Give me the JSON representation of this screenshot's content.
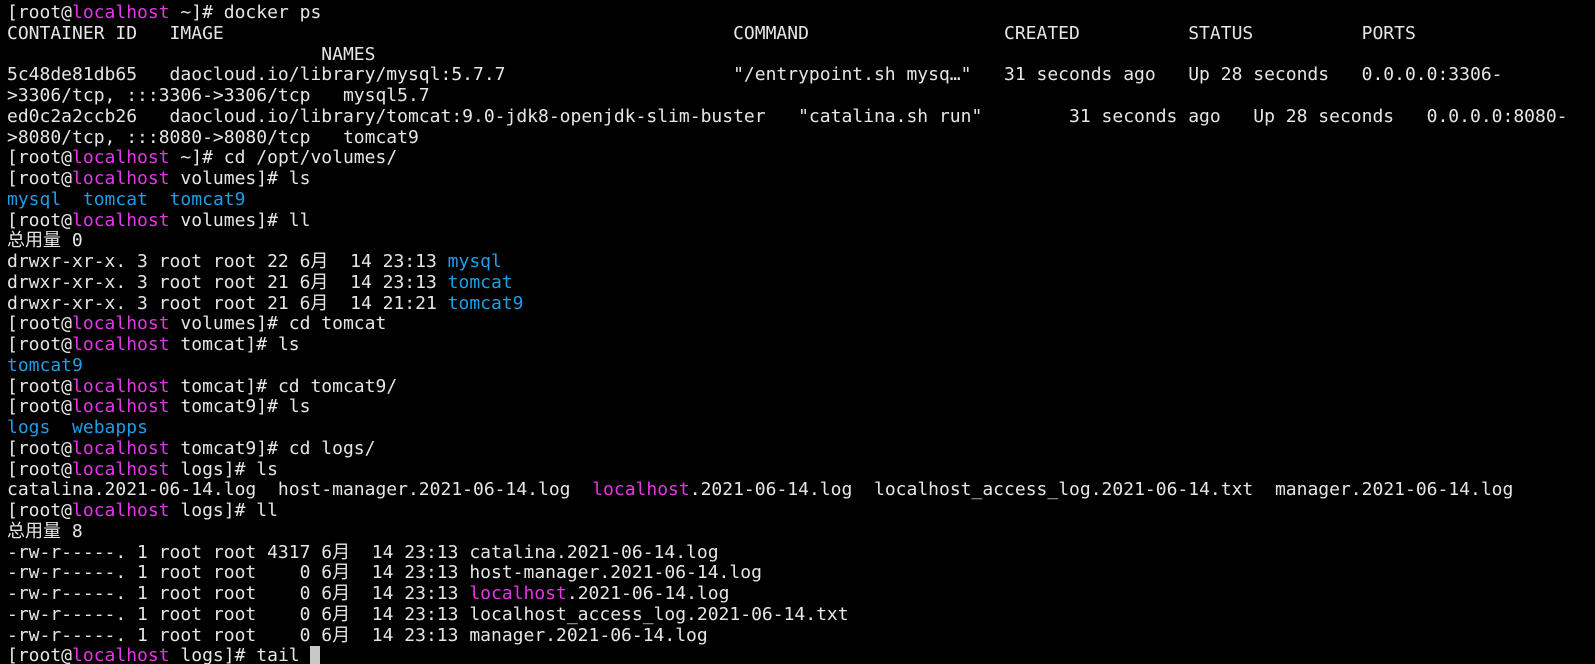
{
  "window": {
    "title": ""
  },
  "colors": {
    "background": "#000000",
    "text": "#e6e6e6",
    "hostname": "#e536e5",
    "directory": "#1e9ee6",
    "cursor": "#c8c8c8"
  },
  "lines": [
    {
      "kind": "prompt",
      "segments": [
        {
          "text": "[root@",
          "style": "default"
        },
        {
          "text": "localhost",
          "style": "host"
        },
        {
          "text": " ~]# docker ps",
          "style": "default"
        }
      ]
    },
    {
      "kind": "output",
      "segments": [
        {
          "text": "CONTAINER ID   IMAGE                                               COMMAND                  CREATED          STATUS          PORTS",
          "style": "default"
        }
      ]
    },
    {
      "kind": "output",
      "segments": [
        {
          "text": "                             NAMES",
          "style": "default"
        }
      ]
    },
    {
      "kind": "output",
      "segments": [
        {
          "text": "5c48de81db65   daocloud.io/library/mysql:5.7.7                     \"/entrypoint.sh mysq…\"   31 seconds ago   Up 28 seconds   0.0.0.0:3306-",
          "style": "default"
        }
      ]
    },
    {
      "kind": "output",
      "segments": [
        {
          "text": ">3306/tcp, :::3306->3306/tcp   mysql5.7",
          "style": "default"
        }
      ]
    },
    {
      "kind": "output",
      "segments": [
        {
          "text": "ed0c2a2ccb26   daocloud.io/library/tomcat:9.0-jdk8-openjdk-slim-buster   \"catalina.sh run\"        31 seconds ago   Up 28 seconds   0.0.0.0:8080-",
          "style": "default"
        }
      ]
    },
    {
      "kind": "output",
      "segments": [
        {
          "text": ">8080/tcp, :::8080->8080/tcp   tomcat9",
          "style": "default"
        }
      ]
    },
    {
      "kind": "prompt",
      "segments": [
        {
          "text": "[root@",
          "style": "default"
        },
        {
          "text": "localhost",
          "style": "host"
        },
        {
          "text": " ~]# cd /opt/volumes/",
          "style": "default"
        }
      ]
    },
    {
      "kind": "prompt",
      "segments": [
        {
          "text": "[root@",
          "style": "default"
        },
        {
          "text": "localhost",
          "style": "host"
        },
        {
          "text": " volumes]# ls",
          "style": "default"
        }
      ]
    },
    {
      "kind": "output",
      "segments": [
        {
          "text": "mysql",
          "style": "dir"
        },
        {
          "text": "  ",
          "style": "default"
        },
        {
          "text": "tomcat",
          "style": "dir"
        },
        {
          "text": "  ",
          "style": "default"
        },
        {
          "text": "tomcat9",
          "style": "dir"
        }
      ]
    },
    {
      "kind": "prompt",
      "segments": [
        {
          "text": "[root@",
          "style": "default"
        },
        {
          "text": "localhost",
          "style": "host"
        },
        {
          "text": " volumes]# ll",
          "style": "default"
        }
      ]
    },
    {
      "kind": "output",
      "segments": [
        {
          "text": "总用量 0",
          "style": "default"
        }
      ]
    },
    {
      "kind": "output",
      "segments": [
        {
          "text": "drwxr-xr-x. 3 root root 22 6月  14 23:13 ",
          "style": "default"
        },
        {
          "text": "mysql",
          "style": "dir"
        }
      ]
    },
    {
      "kind": "output",
      "segments": [
        {
          "text": "drwxr-xr-x. 3 root root 21 6月  14 23:13 ",
          "style": "default"
        },
        {
          "text": "tomcat",
          "style": "dir"
        }
      ]
    },
    {
      "kind": "output",
      "segments": [
        {
          "text": "drwxr-xr-x. 3 root root 21 6月  14 21:21 ",
          "style": "default"
        },
        {
          "text": "tomcat9",
          "style": "dir"
        }
      ]
    },
    {
      "kind": "prompt",
      "segments": [
        {
          "text": "[root@",
          "style": "default"
        },
        {
          "text": "localhost",
          "style": "host"
        },
        {
          "text": " volumes]# cd tomcat",
          "style": "default"
        }
      ]
    },
    {
      "kind": "prompt",
      "segments": [
        {
          "text": "[root@",
          "style": "default"
        },
        {
          "text": "localhost",
          "style": "host"
        },
        {
          "text": " tomcat]# ls",
          "style": "default"
        }
      ]
    },
    {
      "kind": "output",
      "segments": [
        {
          "text": "tomcat9",
          "style": "dir"
        }
      ]
    },
    {
      "kind": "prompt",
      "segments": [
        {
          "text": "[root@",
          "style": "default"
        },
        {
          "text": "localhost",
          "style": "host"
        },
        {
          "text": " tomcat]# cd tomcat9/",
          "style": "default"
        }
      ]
    },
    {
      "kind": "prompt",
      "segments": [
        {
          "text": "[root@",
          "style": "default"
        },
        {
          "text": "localhost",
          "style": "host"
        },
        {
          "text": " tomcat9]# ls",
          "style": "default"
        }
      ]
    },
    {
      "kind": "output",
      "segments": [
        {
          "text": "logs",
          "style": "dir"
        },
        {
          "text": "  ",
          "style": "default"
        },
        {
          "text": "webapps",
          "style": "dir"
        }
      ]
    },
    {
      "kind": "prompt",
      "segments": [
        {
          "text": "[root@",
          "style": "default"
        },
        {
          "text": "localhost",
          "style": "host"
        },
        {
          "text": " tomcat9]# cd logs/",
          "style": "default"
        }
      ]
    },
    {
      "kind": "prompt",
      "segments": [
        {
          "text": "[root@",
          "style": "default"
        },
        {
          "text": "localhost",
          "style": "host"
        },
        {
          "text": " logs]# ls",
          "style": "default"
        }
      ]
    },
    {
      "kind": "output",
      "segments": [
        {
          "text": "catalina.2021-06-14.log  host-manager.2021-06-14.log  ",
          "style": "default"
        },
        {
          "text": "localhost",
          "style": "hostfile"
        },
        {
          "text": ".2021-06-14.log  localhost_access_log.2021-06-14.txt  manager.2021-06-14.log",
          "style": "default"
        }
      ]
    },
    {
      "kind": "prompt",
      "segments": [
        {
          "text": "[root@",
          "style": "default"
        },
        {
          "text": "localhost",
          "style": "host"
        },
        {
          "text": " logs]# ll",
          "style": "default"
        }
      ]
    },
    {
      "kind": "output",
      "segments": [
        {
          "text": "总用量 8",
          "style": "default"
        }
      ]
    },
    {
      "kind": "output",
      "segments": [
        {
          "text": "-rw-r-----. 1 root root 4317 6月  14 23:13 catalina.2021-06-14.log",
          "style": "default"
        }
      ]
    },
    {
      "kind": "output",
      "segments": [
        {
          "text": "-rw-r-----. 1 root root    0 6月  14 23:13 host-manager.2021-06-14.log",
          "style": "default"
        }
      ]
    },
    {
      "kind": "output",
      "segments": [
        {
          "text": "-rw-r-----. 1 root root    0 6月  14 23:13 ",
          "style": "default"
        },
        {
          "text": "localhost",
          "style": "hostfile"
        },
        {
          "text": ".2021-06-14.log",
          "style": "default"
        }
      ]
    },
    {
      "kind": "output",
      "segments": [
        {
          "text": "-rw-r-----. 1 root root    0 6月  14 23:13 localhost_access_log.2021-06-14.txt",
          "style": "default"
        }
      ]
    },
    {
      "kind": "output",
      "segments": [
        {
          "text": "-rw-r-----. 1 root root    0 6月  14 23:13 manager.2021-06-14.log",
          "style": "default"
        }
      ]
    },
    {
      "kind": "prompt",
      "cursor": true,
      "segments": [
        {
          "text": "[root@",
          "style": "default"
        },
        {
          "text": "localhost",
          "style": "host"
        },
        {
          "text": " logs]# tail ",
          "style": "default"
        }
      ]
    }
  ]
}
